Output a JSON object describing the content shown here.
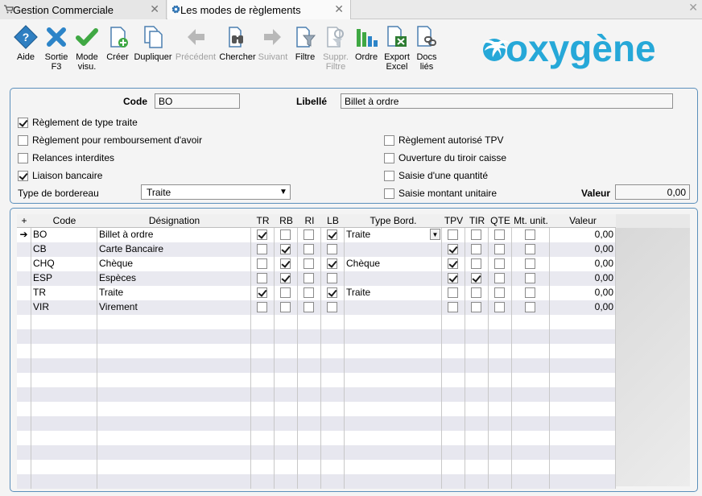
{
  "tabs": [
    {
      "label": "Gestion Commerciale",
      "active": false
    },
    {
      "label": "Les modes de règlements",
      "active": true
    }
  ],
  "window": {
    "close_symbol": "✕"
  },
  "toolbar": [
    {
      "label": "Aide",
      "icon": "help-icon",
      "enabled": true
    },
    {
      "label": "Sortie\nF3",
      "icon": "exit-icon",
      "enabled": true
    },
    {
      "label": "Mode\nvisu.",
      "icon": "checkmark-icon",
      "enabled": true
    },
    {
      "label": "Créer",
      "icon": "new-document-icon",
      "enabled": true
    },
    {
      "label": "Dupliquer",
      "icon": "duplicate-icon",
      "enabled": true
    },
    {
      "label": "Précédent",
      "icon": "arrow-left-icon",
      "enabled": false
    },
    {
      "label": "Chercher",
      "icon": "binoculars-icon",
      "enabled": true
    },
    {
      "label": "Suivant",
      "icon": "arrow-right-icon",
      "enabled": false
    },
    {
      "label": "Filtre",
      "icon": "filter-icon",
      "enabled": true
    },
    {
      "label": "Suppr.\nFiltre",
      "icon": "remove-filter-icon",
      "enabled": false
    },
    {
      "label": "Ordre",
      "icon": "sort-order-icon",
      "enabled": true
    },
    {
      "label": "Export\nExcel",
      "icon": "excel-export-icon",
      "enabled": true
    },
    {
      "label": "Docs\nliés",
      "icon": "linked-docs-icon",
      "enabled": true
    }
  ],
  "logo": {
    "text": "oxygène",
    "color": "#26a8d8"
  },
  "form": {
    "code_label": "Code",
    "code_value": "BO",
    "libelle_label": "Libellé",
    "libelle_value": "Billet à ordre",
    "left_checks": [
      {
        "label": "Règlement de type traite",
        "checked": true
      },
      {
        "label": "Règlement pour remboursement d'avoir",
        "checked": false
      },
      {
        "label": "Relances interdites",
        "checked": false
      },
      {
        "label": "Liaison bancaire",
        "checked": true
      }
    ],
    "right_checks": [
      {
        "label": "Règlement autorisé TPV",
        "checked": false
      },
      {
        "label": "Ouverture du tiroir caisse",
        "checked": false
      },
      {
        "label": "Saisie d'une quantité",
        "checked": false
      },
      {
        "label": "Saisie montant unitaire",
        "checked": false
      }
    ],
    "bordereau_label": "Type de bordereau",
    "bordereau_value": "Traite",
    "valeur_label": "Valeur",
    "valeur_value": "0,00"
  },
  "grid": {
    "columns": [
      "Code",
      "Désignation",
      "TR",
      "RB",
      "RI",
      "LB",
      "Type Bord.",
      "TPV",
      "TIR",
      "QTE",
      "Mt. unit.",
      "Valeur"
    ],
    "rows": [
      {
        "code": "BO",
        "designation": "Billet à ordre",
        "tr": true,
        "rb": false,
        "ri": false,
        "lb": true,
        "type_bord": "Traite",
        "tpv": false,
        "tir": false,
        "qte": false,
        "mt_unit": false,
        "valeur": "0,00",
        "current": true
      },
      {
        "code": "CB",
        "designation": "Carte Bancaire",
        "tr": false,
        "rb": true,
        "ri": false,
        "lb": false,
        "type_bord": "",
        "tpv": true,
        "tir": false,
        "qte": false,
        "mt_unit": false,
        "valeur": "0,00",
        "current": false
      },
      {
        "code": "CHQ",
        "designation": "Chèque",
        "tr": false,
        "rb": true,
        "ri": false,
        "lb": true,
        "type_bord": "Chèque",
        "tpv": true,
        "tir": false,
        "qte": false,
        "mt_unit": false,
        "valeur": "0,00",
        "current": false
      },
      {
        "code": "ESP",
        "designation": "Espèces",
        "tr": false,
        "rb": true,
        "ri": false,
        "lb": false,
        "type_bord": "",
        "tpv": true,
        "tir": true,
        "qte": false,
        "mt_unit": false,
        "valeur": "0,00",
        "current": false
      },
      {
        "code": "TR",
        "designation": "Traite",
        "tr": true,
        "rb": false,
        "ri": false,
        "lb": true,
        "type_bord": "Traite",
        "tpv": false,
        "tir": false,
        "qte": false,
        "mt_unit": false,
        "valeur": "0,00",
        "current": false
      },
      {
        "code": "VIR",
        "designation": "Virement",
        "tr": false,
        "rb": false,
        "ri": false,
        "lb": false,
        "type_bord": "",
        "tpv": false,
        "tir": false,
        "qte": false,
        "mt_unit": false,
        "valeur": "0,00",
        "current": false
      }
    ],
    "current_row_marker": "➔",
    "add_column_symbol": "+"
  }
}
